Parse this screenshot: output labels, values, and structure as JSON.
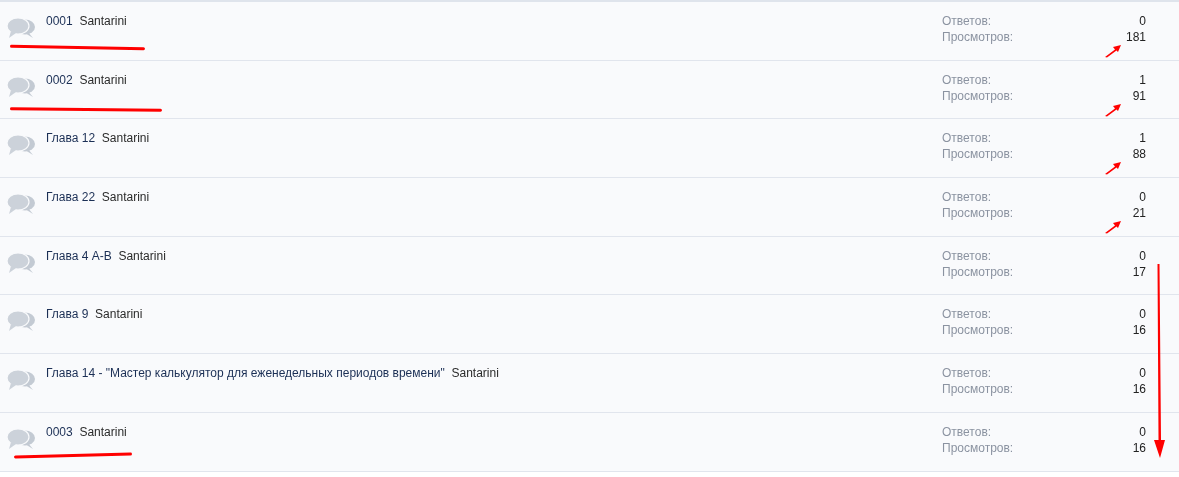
{
  "threads": [
    {
      "title": "0001",
      "author": "Santarini",
      "replies_label": "Ответов:",
      "replies": "0",
      "views_label": "Просмотров:",
      "views": "181",
      "underlined": true,
      "arrow": true
    },
    {
      "title": "0002",
      "author": "Santarini",
      "replies_label": "Ответов:",
      "replies": "1",
      "views_label": "Просмотров:",
      "views": "91",
      "underlined": true,
      "arrow": true
    },
    {
      "title": "Глава 12",
      "author": "Santarini",
      "replies_label": "Ответов:",
      "replies": "1",
      "views_label": "Просмотров:",
      "views": "88",
      "underlined": false,
      "arrow": true
    },
    {
      "title": "Глава 22",
      "author": "Santarini",
      "replies_label": "Ответов:",
      "replies": "0",
      "views_label": "Просмотров:",
      "views": "21",
      "underlined": false,
      "arrow": true
    },
    {
      "title": "Глава 4 А-В",
      "author": "Santarini",
      "replies_label": "Ответов:",
      "replies": "0",
      "views_label": "Просмотров:",
      "views": "17",
      "underlined": false,
      "arrow": false
    },
    {
      "title": "Глава 9",
      "author": "Santarini",
      "replies_label": "Ответов:",
      "replies": "0",
      "views_label": "Просмотров:",
      "views": "16",
      "underlined": false,
      "arrow": false
    },
    {
      "title": "Глава 14 - \"Мастер калькулятор для еженедельных периодов времени\"",
      "author": "Santarini",
      "replies_label": "Ответов:",
      "replies": "0",
      "views_label": "Просмотров:",
      "views": "16",
      "underlined": false,
      "arrow": false
    },
    {
      "title": "0003",
      "author": "Santarini",
      "replies_label": "Ответов:",
      "replies": "0",
      "views_label": "Просмотров:",
      "views": "16",
      "underlined": true,
      "arrow": false
    }
  ],
  "down_arrow": true
}
